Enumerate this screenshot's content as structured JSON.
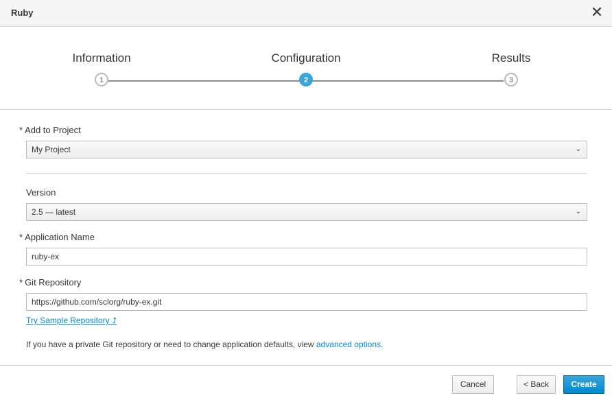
{
  "dialog": {
    "title": "Ruby",
    "close_glyph": "✕"
  },
  "wizard": {
    "steps": [
      {
        "label": "Information",
        "number": "1",
        "state": "inactive"
      },
      {
        "label": "Configuration",
        "number": "2",
        "state": "active"
      },
      {
        "label": "Results",
        "number": "3",
        "state": "inactive"
      }
    ]
  },
  "form": {
    "required_marker": "*",
    "project": {
      "label": "Add to Project",
      "value": "My Project"
    },
    "version": {
      "label": "Version",
      "value": "2.5 — latest"
    },
    "app_name": {
      "label": "Application Name",
      "value": "ruby-ex"
    },
    "git_repo": {
      "label": "Git Repository",
      "value": "https://github.com/sclorg/ruby-ex.git"
    },
    "sample_link": "Try Sample Repository ⮥",
    "hint_text": "If you have a private Git repository or need to change application defaults, view ",
    "hint_link": "advanced options",
    "hint_end": "."
  },
  "footer": {
    "cancel": "Cancel",
    "back": "< Back",
    "create": "Create"
  },
  "colors": {
    "accent": "#39a5dc",
    "link": "#0088ce",
    "primary_button": "#0088ce"
  }
}
